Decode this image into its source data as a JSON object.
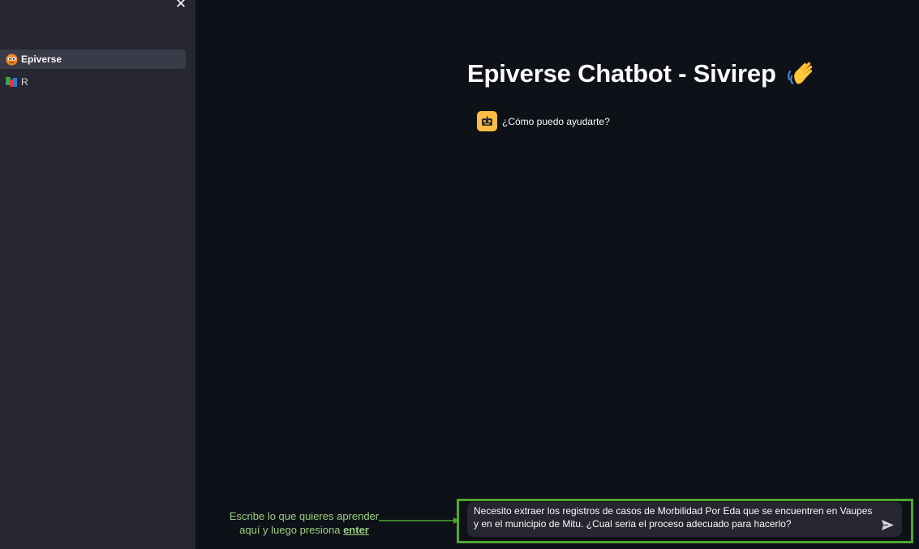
{
  "sidebar": {
    "close_label": "✕",
    "items": [
      {
        "label": "Epiverse",
        "icon": "epiverse-logo-icon",
        "active": true
      },
      {
        "label": "R",
        "icon": "r-logo-icon",
        "active": false
      }
    ]
  },
  "main": {
    "title": "Epiverse Chatbot - Sivirep",
    "title_icon": "waving-hand-icon",
    "assistant_message": "¿Cómo puedo ayudarte?",
    "assistant_avatar": "robot-icon"
  },
  "hint": {
    "line1": "Escribe lo que quieres aprender",
    "line2": "aquí y luego presiona",
    "keyword": "enter"
  },
  "chat_input": {
    "value": "Necesito extraer los registros de casos de Morbilidad Por Eda que se encuentren en Vaupes y en el municipio de Mitu. ¿Cual seria el proceso adecuado para hacerlo?",
    "send_icon": "send-icon"
  },
  "colors": {
    "background": "#0e1117",
    "sidebar": "#262730",
    "active_item": "#393b48",
    "avatar": "#ffbd45",
    "annotation": "#4fa72f",
    "hint_text": "#9bd07e"
  }
}
